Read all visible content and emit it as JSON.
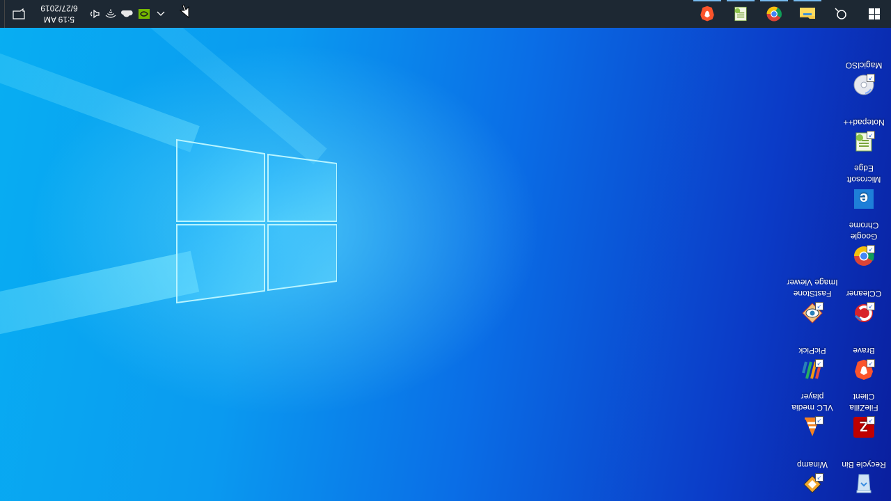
{
  "desktop": {
    "icons": [
      {
        "name": "recycle-bin",
        "label": "Recycle Bin",
        "icon": "recycle-bin-icon"
      },
      {
        "name": "filezilla",
        "label": "FileZilla Client",
        "icon": "filezilla-icon"
      },
      {
        "name": "brave",
        "label": "Brave",
        "icon": "brave-icon"
      },
      {
        "name": "ccleaner",
        "label": "CCleaner",
        "icon": "ccleaner-icon"
      },
      {
        "name": "chrome",
        "label": "Google Chrome",
        "icon": "chrome-icon"
      },
      {
        "name": "edge",
        "label": "Microsoft Edge",
        "icon": "edge-icon"
      },
      {
        "name": "notepadpp",
        "label": "Notepad++",
        "icon": "notepadpp-icon"
      },
      {
        "name": "magiciso",
        "label": "MagicISO",
        "icon": "magiciso-icon"
      },
      {
        "name": "winamp",
        "label": "Winamp",
        "icon": "winamp-icon"
      },
      {
        "name": "vlc",
        "label": "VLC media player",
        "icon": "vlc-icon"
      },
      {
        "name": "picpick",
        "label": "PicPick",
        "icon": "picpick-icon"
      },
      {
        "name": "faststone",
        "label": "FastStone Image Viewer",
        "icon": "faststone-icon"
      }
    ]
  },
  "taskbar": {
    "start_icon": "windows-start-icon",
    "search_icon": "cortana-search-icon",
    "pinned": [
      {
        "name": "file-explorer",
        "icon": "folder-icon",
        "active": true
      },
      {
        "name": "chrome",
        "icon": "chrome-icon",
        "active": true
      },
      {
        "name": "notepadpp",
        "icon": "notepadpp-icon",
        "active": true
      },
      {
        "name": "brave",
        "icon": "brave-icon",
        "active": true
      }
    ],
    "tray": {
      "time": "5:19 AM",
      "date": "6/27/2019"
    }
  },
  "colors": {
    "taskbar_bg": "#1d2833",
    "accent": "#76b9ed",
    "wallpaper_blue": "#0a6ee6"
  }
}
